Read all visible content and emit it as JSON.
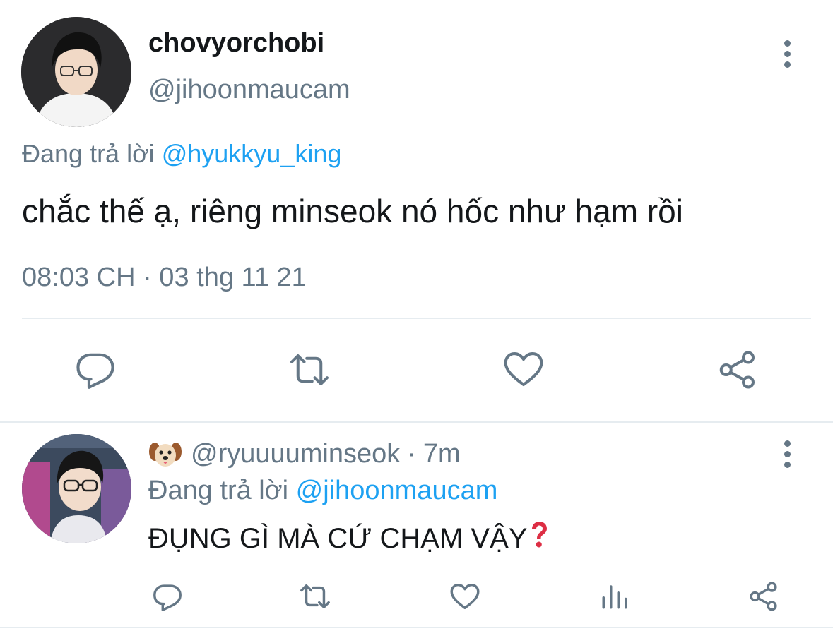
{
  "main_tweet": {
    "display_name": "chovyorchobi",
    "handle": "@jihoonmaucam",
    "replying_prefix": "Đang trả lời",
    "replying_to": "@hyukkyu_king",
    "text": "chắc thế ạ, riêng minseok nó hốc như hạm rồi",
    "timestamp": "08:03 CH · 03 thg 11 21",
    "avatar_icon": "user-avatar-photo",
    "actions": [
      "reply-icon",
      "retweet-icon",
      "like-icon",
      "share-icon"
    ]
  },
  "reply_tweet": {
    "emoji_icon": "dog-face-emoji",
    "handle": "@ryuuuuminseok",
    "separator": "·",
    "time_ago": "7m",
    "replying_prefix": "Đang trả lời",
    "replying_to": "@jihoonmaucam",
    "text": "ĐỤNG GÌ MÀ CỨ CHẠM VẬY",
    "text_emoji_icon": "red-question-mark-emoji",
    "avatar_icon": "user-avatar-photo",
    "actions": [
      "reply-icon",
      "retweet-icon",
      "like-icon",
      "analytics-icon",
      "share-icon"
    ]
  },
  "colors": {
    "text_primary": "#14171a",
    "text_secondary": "#657786",
    "link": "#1da1f2",
    "divider": "#e6ecf0"
  }
}
